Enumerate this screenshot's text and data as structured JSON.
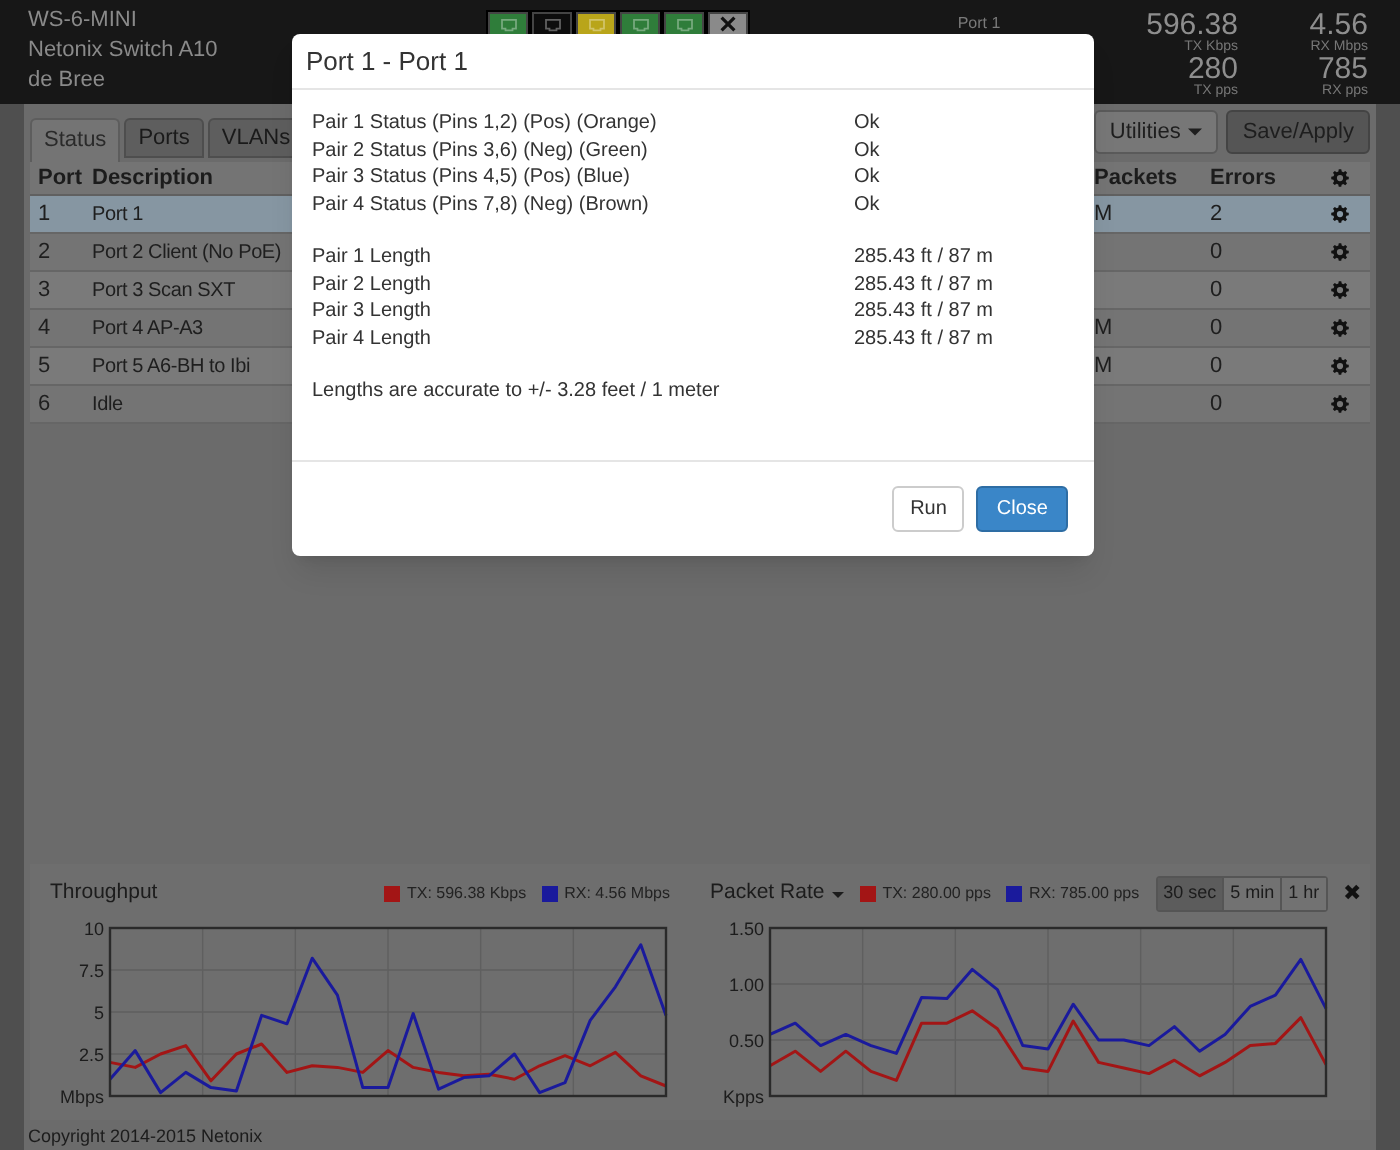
{
  "header": {
    "lines": [
      "WS-6-MINI",
      "Netonix Switch A10",
      "de Bree"
    ],
    "selected_port": "Port 1"
  },
  "port_icons": [
    {
      "kind": "port",
      "color": "#2f7d3a"
    },
    {
      "kind": "port",
      "color": "#0d0d0d"
    },
    {
      "kind": "port",
      "color": "#b9a51a"
    },
    {
      "kind": "port",
      "color": "#2f7d3a"
    },
    {
      "kind": "port",
      "color": "#2f7d3a"
    },
    {
      "kind": "disabled",
      "color": "#8a8a8a"
    }
  ],
  "stats": [
    {
      "value": "596.38",
      "unit": "TX Kbps"
    },
    {
      "value": "4.56",
      "unit": "RX Mbps"
    },
    {
      "value": "280",
      "unit": "TX pps"
    },
    {
      "value": "785",
      "unit": "RX pps"
    }
  ],
  "tabs": [
    {
      "label": "Status",
      "selected": true
    },
    {
      "label": "Ports",
      "selected": false
    },
    {
      "label": "VLANs",
      "selected": false
    }
  ],
  "buttons": [
    {
      "label": "Utilities",
      "dropdown": true
    },
    {
      "label": "Save/Apply",
      "dropdown": false
    }
  ],
  "table": {
    "columns": [
      "Port",
      "Description",
      "Packets",
      "Errors"
    ],
    "rows": [
      {
        "port": "1",
        "description": "Port 1",
        "packets": "M",
        "errors": "2",
        "selected": true
      },
      {
        "port": "2",
        "description": "Port 2 Client (No PoE)",
        "packets": "",
        "errors": "0",
        "selected": false
      },
      {
        "port": "3",
        "description": "Port 3 Scan SXT",
        "packets": "",
        "errors": "0",
        "selected": false
      },
      {
        "port": "4",
        "description": "Port 4 AP-A3",
        "packets": "M",
        "errors": "0",
        "selected": false
      },
      {
        "port": "5",
        "description": "Port 5 A6-BH to Ibi",
        "packets": "M",
        "errors": "0",
        "selected": false
      },
      {
        "port": "6",
        "description": "Idle",
        "packets": "",
        "errors": "0",
        "selected": false
      }
    ]
  },
  "charts": [
    {
      "title": "Throughput",
      "dropdown": false,
      "chart_data": {
        "type": "line",
        "grid": true,
        "ylim": [
          0,
          10
        ],
        "yticks": [
          {
            "value": 0,
            "label": "Mbps"
          },
          2.5,
          5,
          7.5,
          10
        ],
        "series": [
          {
            "name": "TX: 596.38 Kbps",
            "color": "#a31515",
            "values": [
              2,
              1.7,
              2.5,
              3,
              0.9,
              2.5,
              3.1,
              1.4,
              1.8,
              1.7,
              1.4,
              2.7,
              1.7,
              1.4,
              1.2,
              1.3,
              1.0,
              1.8,
              2.4,
              1.8,
              2.6,
              1.2,
              0.6
            ]
          },
          {
            "name": "RX: 4.56 Mbps",
            "color": "#1a1a9c",
            "values": [
              1,
              2.7,
              0.2,
              1.4,
              0.5,
              0.3,
              4.8,
              4.3,
              8.2,
              6,
              0.5,
              0.5,
              4.9,
              0.4,
              1.1,
              1.2,
              2.5,
              0.2,
              0.8,
              4.5,
              6.5,
              9,
              4.8
            ]
          }
        ]
      }
    },
    {
      "title": "Packet Rate",
      "dropdown": true,
      "chart_data": {
        "type": "line",
        "grid": true,
        "ylim": [
          0,
          1.5
        ],
        "yticks": [
          {
            "value": 0,
            "label": "Kpps"
          },
          {
            "value": 0.5,
            "label": "0.50"
          },
          {
            "value": 1,
            "label": "1.00"
          },
          {
            "value": 1.5,
            "label": "1.50"
          }
        ],
        "series": [
          {
            "name": "TX: 280.00 pps",
            "color": "#a31515",
            "values": [
              0.27,
              0.4,
              0.22,
              0.4,
              0.22,
              0.14,
              0.65,
              0.65,
              0.76,
              0.6,
              0.25,
              0.22,
              0.67,
              0.3,
              0.25,
              0.2,
              0.32,
              0.18,
              0.3,
              0.45,
              0.47,
              0.7,
              0.28
            ]
          },
          {
            "name": "RX: 785.00 pps",
            "color": "#1a1a9c",
            "values": [
              0.55,
              0.65,
              0.45,
              0.55,
              0.45,
              0.38,
              0.88,
              0.87,
              1.13,
              0.95,
              0.45,
              0.42,
              0.82,
              0.5,
              0.5,
              0.45,
              0.62,
              0.4,
              0.55,
              0.8,
              0.9,
              1.22,
              0.78
            ]
          }
        ]
      }
    }
  ],
  "ranges": [
    {
      "label": "30 sec",
      "selected": true
    },
    {
      "label": "5 min",
      "selected": false
    },
    {
      "label": "1 hr",
      "selected": false
    }
  ],
  "close_charts": "✖",
  "footer": "Copyright 2014-2015 Netonix",
  "modal": {
    "title": "Port 1 - Port 1",
    "status": [
      {
        "label": "Pair 1 Status (Pins 1,2) (Pos) (Orange)",
        "value": "Ok"
      },
      {
        "label": "Pair 2 Status (Pins 3,6) (Neg) (Green)",
        "value": "Ok"
      },
      {
        "label": "Pair 3 Status (Pins 4,5) (Pos) (Blue)",
        "value": "Ok"
      },
      {
        "label": "Pair 4 Status (Pins 7,8) (Neg) (Brown)",
        "value": "Ok"
      }
    ],
    "lengths": [
      {
        "label": "Pair 1 Length",
        "value": "285.43 ft / 87 m"
      },
      {
        "label": "Pair 2 Length",
        "value": "285.43 ft / 87 m"
      },
      {
        "label": "Pair 3 Length",
        "value": "285.43 ft / 87 m"
      },
      {
        "label": "Pair 4 Length",
        "value": "285.43 ft / 87 m"
      }
    ],
    "note": "Lengths are accurate to +/- 3.28 feet / 1 meter",
    "buttons": [
      {
        "label": "Run",
        "primary": false
      },
      {
        "label": "Close",
        "primary": true
      }
    ]
  }
}
